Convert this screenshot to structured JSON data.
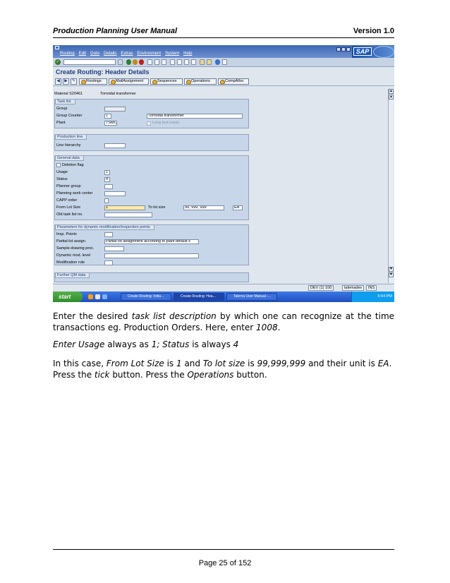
{
  "document": {
    "header_title": "Production Planning User Manual",
    "header_version": "Version 1.0",
    "footer": "Page 25 of 152"
  },
  "sap": {
    "menu": [
      "Routing",
      "Edit",
      "Goto",
      "Details",
      "Extras",
      "Environment",
      "System",
      "Help"
    ],
    "logo": "SAP",
    "screen_title": "Create Routing: Header Details",
    "app_buttons": [
      "Routings",
      "MatlAssignment",
      "Sequences",
      "Operations",
      "CompAlloc"
    ],
    "material_label": "Material",
    "material_number": "S20461",
    "material_desc": "Torroidal transformer",
    "task_list": {
      "title": "Task list",
      "group_label": "Group",
      "group_counter_label": "Group Counter",
      "group_counter_value": "1",
      "group_counter_text": "Torroidal transformer",
      "plant_label": "Plant",
      "plant_value": "TSMO",
      "long_text_label": "Long text exists"
    },
    "production_line": {
      "title": "Production line",
      "line_hierarchy_label": "Line hierarchy"
    },
    "general_data": {
      "title": "General data",
      "deletion_flag_label": "Deletion flag",
      "usage_label": "Usage",
      "usage_value": "1",
      "status_label": "Status",
      "status_value": "4",
      "planner_group_label": "Planner group",
      "planning_work_center_label": "Planning work center",
      "capp_order_label": "CAPP order",
      "from_lot_size_label": "From Lot Size",
      "from_lot_size_value": "1",
      "to_lot_size_label": "To lot size",
      "to_lot_size_value": "99, 999, 999",
      "unit_value": "EA",
      "old_task_list_label": "Old task list no."
    },
    "parameters": {
      "title": "Parameters for dynamic modification/inspection points",
      "insp_points_label": "Insp. Points",
      "partial_lot_label": "Partial-lot assign.",
      "partial_lot_value": "Partial lot assignment according to plant default s",
      "sample_drawing_label": "Sample-drawing proc.",
      "dynamic_mod_label": "Dynamic mod. level",
      "modification_rule_label": "Modification rule"
    },
    "further_qm": {
      "title": "Further QM data"
    },
    "status_bar": {
      "system": "DEV (1) 100",
      "server": "talemadev",
      "mode": "INS"
    },
    "taskbar": {
      "start": "start",
      "tasks": [
        "Create Routing: Initia...",
        "Create Routing: Hea...",
        "Talema User Manual -..."
      ],
      "clock": "6:54 PM"
    }
  },
  "body": {
    "p1_a": "Enter the desired ",
    "p1_em": "task list description",
    "p1_b": " by which one can recognize at the time transactions eg. Production Orders. Here, enter ",
    "p1_em2": "1008",
    "p1_c": ".",
    "p2_em": "Enter Usage",
    "p2_a": " always as ",
    "p2_em2": "1; Status",
    "p2_b": " is always ",
    "p2_em3": "4",
    "p3_a": "In this case, ",
    "p3_em": "From Lot Size",
    "p3_b": " is ",
    "p3_em2": "1",
    "p3_c": " and ",
    "p3_em3": "To lot size",
    "p3_d": " is ",
    "p3_em4": "99,999,999",
    "p3_e": "  and their unit is ",
    "p3_em5": "EA",
    "p3_f": ". Press the ",
    "p3_em6": "tick",
    "p3_g": " button. Press the ",
    "p3_em7": "Operations",
    "p3_h": " button."
  }
}
